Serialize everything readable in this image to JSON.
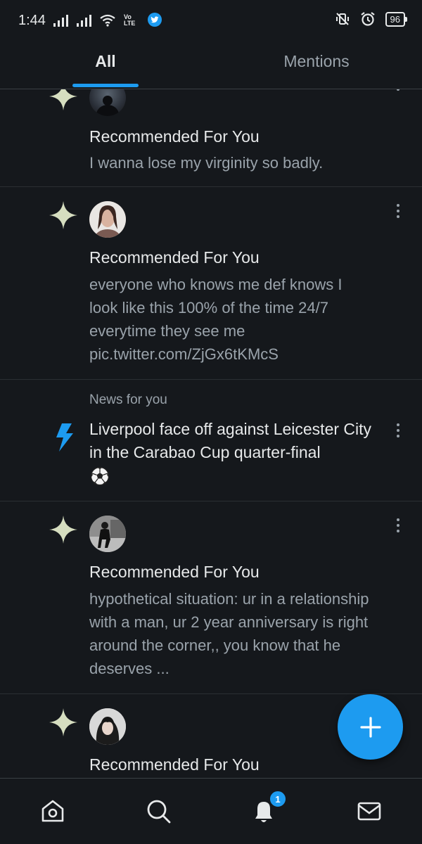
{
  "status_bar": {
    "time": "1:44",
    "network": "Vo LTE",
    "battery": "96"
  },
  "tabs": [
    {
      "label": "All",
      "active": true
    },
    {
      "label": "Mentions",
      "active": false
    }
  ],
  "feed": [
    {
      "type": "recommended",
      "title": "Recommended For You",
      "body": "I wanna lose my virginity so badly."
    },
    {
      "type": "recommended",
      "title": "Recommended For You",
      "body": "everyone who knows me def knows I look like this 100% of the time 24/7 everytime they see me pic.twitter.com/ZjGx6tKMcS"
    },
    {
      "type": "news",
      "label": "News for you",
      "title": "Liverpool face off against Leicester City in the Carabao Cup quarter-final"
    },
    {
      "type": "recommended",
      "title": "Recommended For You",
      "body": "hypothetical situation: ur in a relationship with a man, ur 2 year anniversary is right around the corner,, you know that he deserves ..."
    },
    {
      "type": "recommended",
      "title": "Recommended For You",
      "body": ""
    }
  ],
  "bottom_nav": {
    "items": [
      "home-icon",
      "search-icon",
      "notifications-icon",
      "messages-icon"
    ],
    "notification_count": "1"
  },
  "colors": {
    "background": "#15181c",
    "accent": "#1d9bf0",
    "sparkle": "#d6dec0",
    "secondary_text": "#9aa3ab"
  }
}
